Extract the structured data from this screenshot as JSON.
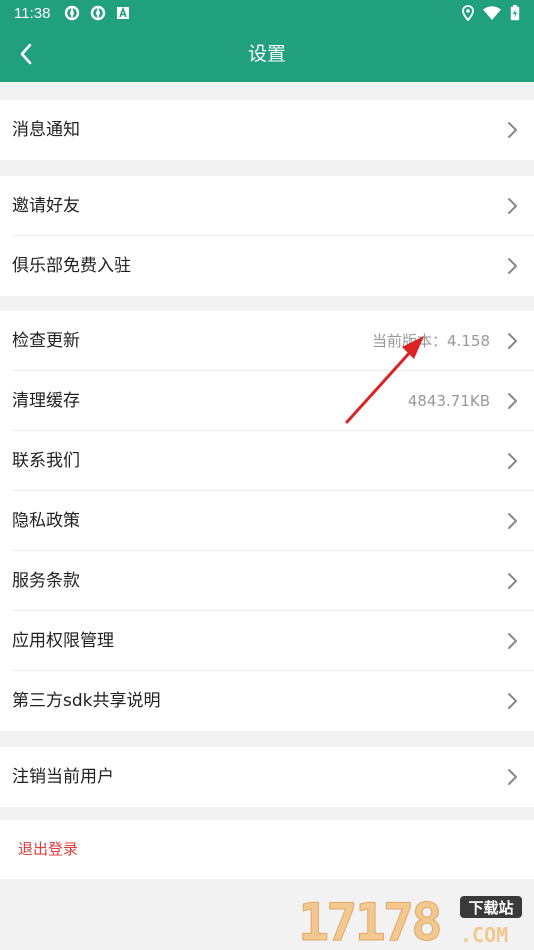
{
  "status_bar": {
    "time": "11:38",
    "left_icons": [
      "app-notification-icon",
      "app-notification-icon",
      "a-letter-icon"
    ],
    "right_icons": [
      "location-icon",
      "wifi-icon",
      "battery-icon"
    ]
  },
  "app_bar": {
    "title": "设置",
    "back_icon": "back-arrow-icon"
  },
  "groups": [
    {
      "items": [
        {
          "label": "消息通知"
        }
      ]
    },
    {
      "items": [
        {
          "label": "邀请好友"
        },
        {
          "label": "俱乐部免费入驻"
        }
      ]
    },
    {
      "items": [
        {
          "label": "检查更新",
          "value": "当前版本：4.158"
        },
        {
          "label": "清理缓存",
          "value": "4843.71KB"
        },
        {
          "label": "联系我们"
        },
        {
          "label": "隐私政策"
        },
        {
          "label": "服务条款"
        },
        {
          "label": "应用权限管理"
        },
        {
          "label": "第三方sdk共享说明"
        }
      ]
    },
    {
      "items": [
        {
          "label": "注销当前用户"
        }
      ]
    }
  ],
  "logout": {
    "label": "退出登录"
  },
  "watermark": {
    "text": "17178",
    "badge": "下载站",
    "suffix": ".COM"
  },
  "colors": {
    "primary": "#20a07c",
    "danger": "#e23c3c",
    "annotation": "#d92424"
  }
}
